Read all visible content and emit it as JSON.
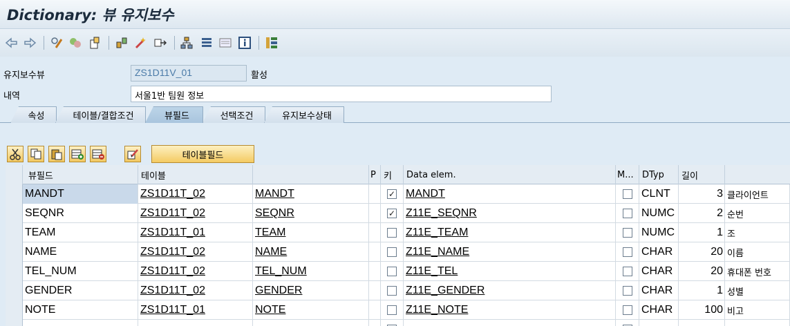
{
  "title": "Dictionary: 뷰 유지보수",
  "header": {
    "view_label": "유지보수뷰",
    "view_value": "ZS1D11V_01",
    "status": "활성",
    "desc_label": "내역",
    "desc_value": "서울1반 팀원 정보"
  },
  "tabs": [
    "속성",
    "테이블/결합조건",
    "뷰필드",
    "선택조건",
    "유지보수상태"
  ],
  "active_tab": "뷰필드",
  "table_field_button": "테이블필드",
  "columns": {
    "viewfield": "뷰필드",
    "table": "테이블",
    "field": "",
    "p": "P",
    "key": "키",
    "data_elem": "Data elem.",
    "m": "M...",
    "dtyp": "DTyp",
    "length": "길이",
    "short_text": ""
  },
  "rows": [
    {
      "viewfield": "MANDT",
      "table": "ZS1D11T_02",
      "field": "MANDT",
      "key": true,
      "data_elem": "MANDT",
      "m": false,
      "dtyp": "CLNT",
      "length": "3",
      "text": "클라이언트"
    },
    {
      "viewfield": "SEQNR",
      "table": "ZS1D11T_02",
      "field": "SEQNR",
      "key": true,
      "data_elem": "Z11E_SEQNR",
      "m": false,
      "dtyp": "NUMC",
      "length": "2",
      "text": "순번"
    },
    {
      "viewfield": "TEAM",
      "table": "ZS1D11T_01",
      "field": "TEAM",
      "key": false,
      "data_elem": "Z11E_TEAM",
      "m": false,
      "dtyp": "NUMC",
      "length": "1",
      "text": "조"
    },
    {
      "viewfield": "NAME",
      "table": "ZS1D11T_02",
      "field": "NAME",
      "key": false,
      "data_elem": "Z11E_NAME",
      "m": false,
      "dtyp": "CHAR",
      "length": "20",
      "text": "이름"
    },
    {
      "viewfield": "TEL_NUM",
      "table": "ZS1D11T_02",
      "field": "TEL_NUM",
      "key": false,
      "data_elem": "Z11E_TEL",
      "m": false,
      "dtyp": "CHAR",
      "length": "20",
      "text": "휴대폰 번호"
    },
    {
      "viewfield": "GENDER",
      "table": "ZS1D11T_02",
      "field": "GENDER",
      "key": false,
      "data_elem": "Z11E_GENDER",
      "m": false,
      "dtyp": "CHAR",
      "length": "1",
      "text": "성별"
    },
    {
      "viewfield": "NOTE",
      "table": "ZS1D11T_01",
      "field": "NOTE",
      "key": false,
      "data_elem": "Z11E_NOTE",
      "m": false,
      "dtyp": "CHAR",
      "length": "100",
      "text": "비고"
    }
  ],
  "toolbar_icons": [
    "back-icon",
    "forward-icon",
    "display-change-icon",
    "active-inactive-icon",
    "other-object-icon",
    "check-icon",
    "activate-icon",
    "where-used-icon",
    "hierarchy-icon",
    "object-list-icon",
    "display-object-list-icon",
    "info-icon",
    "layout-icon"
  ]
}
